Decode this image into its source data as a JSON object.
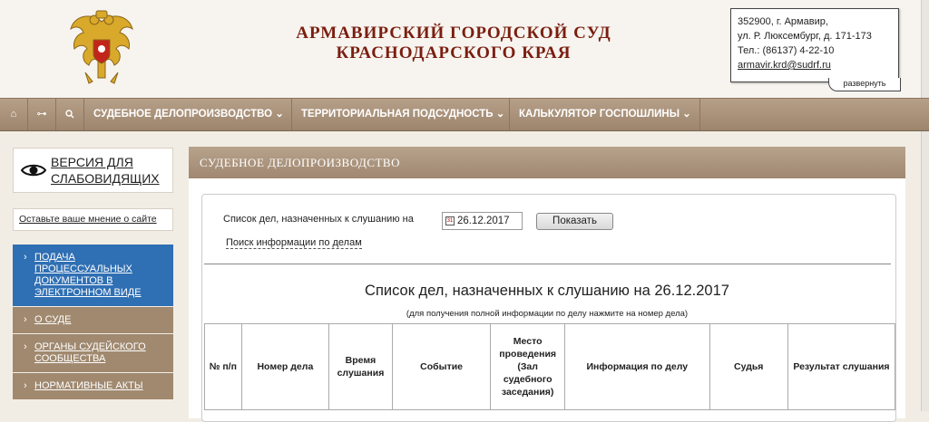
{
  "header": {
    "title_line1": "АРМАВИРСКИЙ ГОРОДСКОЙ СУД",
    "title_line2": "КРАСНОДАРСКОГО КРАЯ",
    "emblem_icon": "coat-of-arms-icon",
    "contact": {
      "address1": "352900, г. Армавир,",
      "address2": "ул. Р. Люксембург, д. 171-173",
      "phone": "Тел.: (86137) 4-22-10",
      "email": "armavir.krd@sudrf.ru",
      "expand_label": "развернуть"
    }
  },
  "navbar": {
    "icons": [
      "home-icon",
      "sitemap-icon",
      "search-icon"
    ],
    "items": [
      {
        "label": "СУДЕБНОЕ ДЕЛОПРОИЗВОДСТВО ⌄"
      },
      {
        "label": "ТЕРРИТОРИАЛЬНАЯ ПОДСУДНОСТЬ ⌄"
      },
      {
        "label": "КАЛЬКУЛЯТОР ГОСПОШЛИНЫ ⌄"
      }
    ]
  },
  "sidebar": {
    "vision_line1": "ВЕРСИЯ ДЛЯ",
    "vision_line2": "СЛАБОВИДЯЩИХ",
    "feedback": "Оставьте ваше мнение о сайте",
    "items": [
      {
        "label": "ПОДАЧА ПРОЦЕССУАЛЬНЫХ ДОКУМЕНТОВ В ЭЛЕКТРОННОМ ВИДЕ",
        "active": true
      },
      {
        "label": "О СУДЕ",
        "active": false
      },
      {
        "label": "ОРГАНЫ СУДЕЙСКОГО СООБЩЕСТВА",
        "active": false
      },
      {
        "label": "НОРМАТИВНЫЕ АКТЫ",
        "active": false
      }
    ],
    "arrow": "›"
  },
  "main": {
    "section_title": "СУДЕБНОЕ ДЕЛОПРОИЗВОДСТВО",
    "list_label": "Список дел, назначенных к слушанию на",
    "date_value": "26.12.2017",
    "show_button": "Показать",
    "search_link": "Поиск информации по делам",
    "table_title": "Список дел, назначенных к слушанию на 26.12.2017",
    "table_note": "(для получения полной информации по делу нажмите на номер дела)",
    "columns": [
      "№ п/п",
      "Номер дела",
      "Время слушания",
      "Событие",
      "Место проведения (Зал судебного заседания)",
      "Информация по делу",
      "Судья",
      "Результат слушания"
    ]
  },
  "colors": {
    "title_red": "#7a1e10",
    "nav_brown": "#a08871",
    "active_blue": "#2f6fb3"
  }
}
